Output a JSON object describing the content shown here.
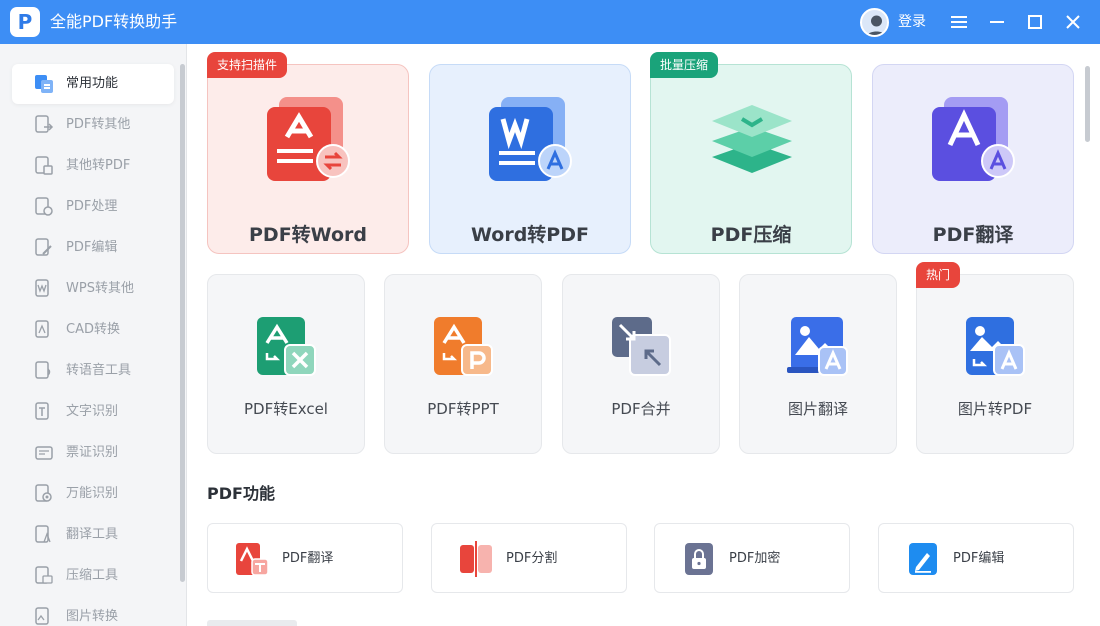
{
  "app": {
    "logo_glyph": "P",
    "title": "全能PDF转换助手",
    "login_label": "登录",
    "accent_color": "#3d8ef5"
  },
  "window_controls": {
    "menu_icon": "menu-icon",
    "minimize_icon": "minimize-icon",
    "maximize_icon": "maximize-icon",
    "close_icon": "close-icon"
  },
  "sidebar": {
    "items": [
      {
        "label": "常用功能",
        "icon": "common-functions-icon",
        "active": true
      },
      {
        "label": "PDF转其他",
        "icon": "pdf-to-other-icon"
      },
      {
        "label": "其他转PDF",
        "icon": "other-to-pdf-icon"
      },
      {
        "label": "PDF处理",
        "icon": "pdf-process-icon"
      },
      {
        "label": "PDF编辑",
        "icon": "pdf-edit-icon"
      },
      {
        "label": "WPS转其他",
        "icon": "wps-convert-icon"
      },
      {
        "label": "CAD转换",
        "icon": "cad-convert-icon"
      },
      {
        "label": "转语音工具",
        "icon": "text-to-speech-icon"
      },
      {
        "label": "文字识别",
        "icon": "ocr-icon"
      },
      {
        "label": "票证识别",
        "icon": "ticket-recognition-icon"
      },
      {
        "label": "万能识别",
        "icon": "universal-recognition-icon"
      },
      {
        "label": "翻译工具",
        "icon": "translate-tool-icon"
      },
      {
        "label": "压缩工具",
        "icon": "compress-tool-icon"
      },
      {
        "label": "图片转换",
        "icon": "image-convert-icon"
      }
    ]
  },
  "featured": [
    {
      "label": "PDF转Word",
      "badge": "支持扫描件",
      "badge_color": "#e8453c",
      "bg": "#fdecea",
      "border": "#f5c4c0"
    },
    {
      "label": "Word转PDF",
      "badge": "",
      "bg": "#e7f0fd",
      "border": "#c6dbf7"
    },
    {
      "label": "PDF压缩",
      "badge": "批量压缩",
      "badge_color": "#1aa37a",
      "bg": "#e2f6f0",
      "border": "#b6e3d4"
    },
    {
      "label": "PDF翻译",
      "badge": "",
      "bg": "#ecedfb",
      "border": "#d3d6f3"
    }
  ],
  "tools": [
    {
      "label": "PDF转Excel",
      "badge": ""
    },
    {
      "label": "PDF转PPT",
      "badge": ""
    },
    {
      "label": "PDF合并",
      "badge": ""
    },
    {
      "label": "图片翻译",
      "badge": ""
    },
    {
      "label": "图片转PDF",
      "badge": "热门",
      "badge_color": "#e8453c"
    }
  ],
  "pdf_section": {
    "title": "PDF功能",
    "items": [
      {
        "label": "PDF翻译",
        "icon": "pdf-translate-icon"
      },
      {
        "label": "PDF分割",
        "icon": "pdf-split-icon"
      },
      {
        "label": "PDF加密",
        "icon": "pdf-encrypt-icon"
      },
      {
        "label": "PDF编辑",
        "icon": "pdf-edit-icon"
      }
    ]
  }
}
